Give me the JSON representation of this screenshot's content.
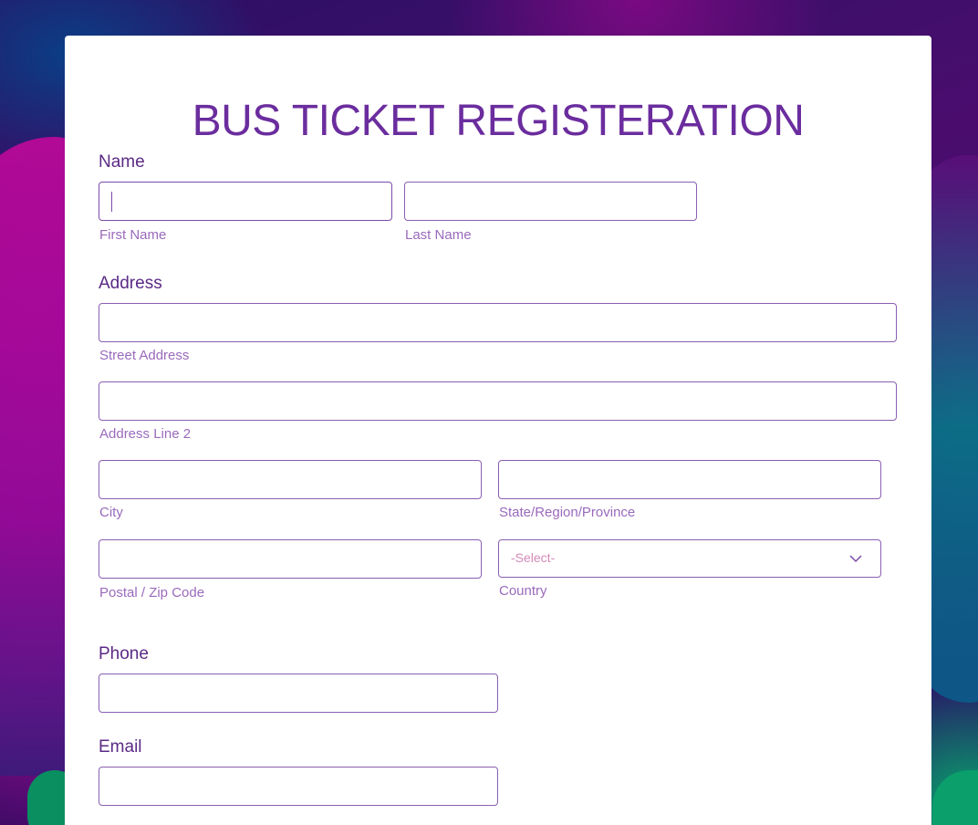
{
  "form": {
    "title": "BUS TICKET REGISTERATION",
    "name": {
      "label": "Name",
      "first_sublabel": "First Name",
      "last_sublabel": "Last Name",
      "first_value": "",
      "last_value": ""
    },
    "address": {
      "label": "Address",
      "street_sublabel": "Street Address",
      "line2_sublabel": "Address Line 2",
      "city_sublabel": "City",
      "state_sublabel": "State/Region/Province",
      "postal_sublabel": "Postal / Zip Code",
      "country_sublabel": "Country",
      "country_placeholder": "-Select-"
    },
    "phone": {
      "label": "Phone"
    },
    "email": {
      "label": "Email"
    }
  },
  "colors": {
    "accent": "#6b2d9e",
    "label": "#5b2a86",
    "sublabel": "#9a6abc",
    "border": "#8a5fb2",
    "placeholder": "#d68ab8"
  },
  "icons": {
    "country_dropdown": "chevron-down-icon"
  }
}
